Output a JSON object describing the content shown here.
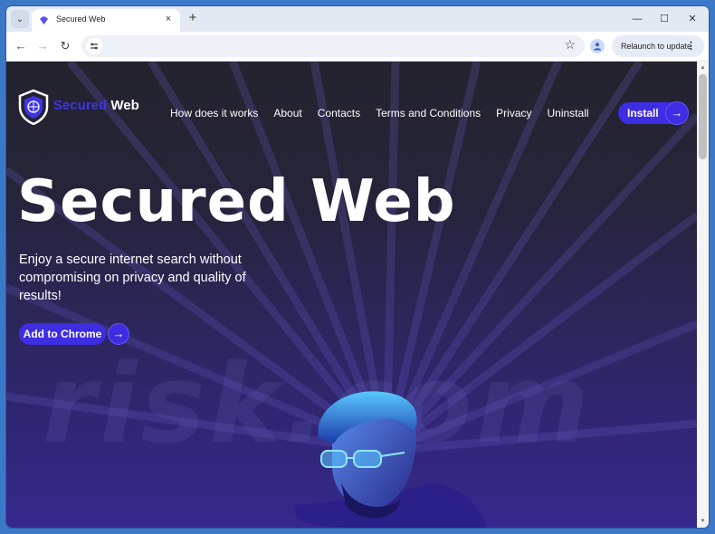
{
  "browser": {
    "tab_title": "Secured Web",
    "tab_close_icon": "×",
    "new_tab_icon": "+",
    "relaunch_label": "Relaunch to update",
    "window_controls": {
      "minimize": "—",
      "maximize": "☐",
      "close": "✕"
    }
  },
  "site": {
    "logo_text_accent": "Secured",
    "logo_text_rest": " Web",
    "nav": [
      "How does it works",
      "About",
      "Contacts",
      "Terms and Conditions",
      "Privacy",
      "Uninstall"
    ],
    "install_label": "Install",
    "hero_title": "Secured Web",
    "hero_subtitle": "Enjoy a secure internet search without compromising on privacy and quality of results!",
    "cta_label": "Add to Chrome",
    "watermark": "risk.com"
  },
  "colors": {
    "accent": "#3d2de3",
    "background_top": "#24232e",
    "background_bottom": "#36278d"
  }
}
